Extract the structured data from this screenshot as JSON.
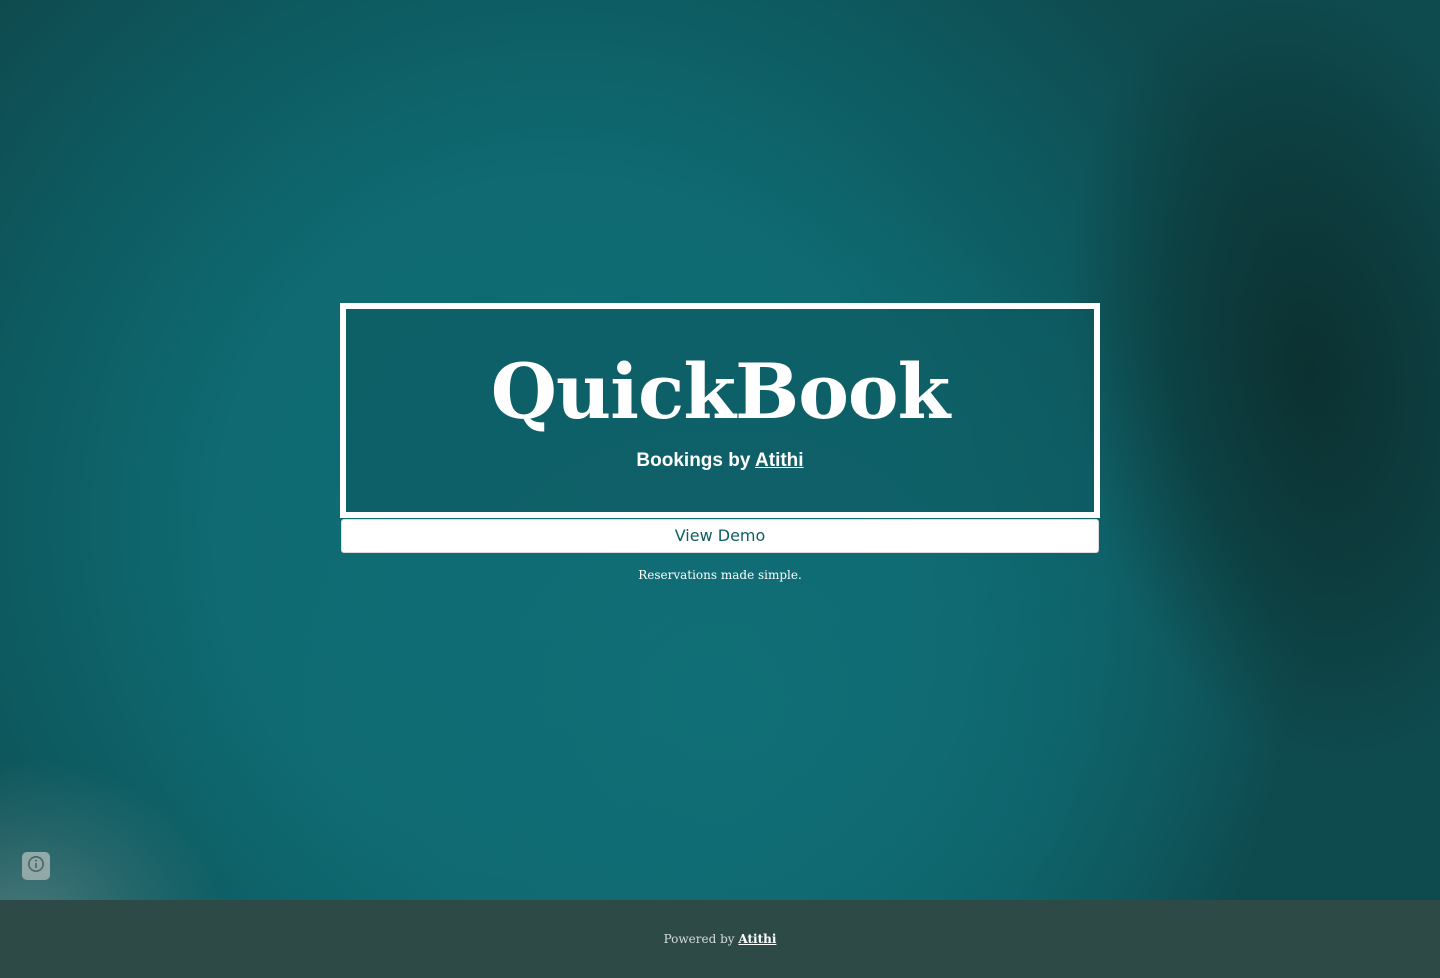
{
  "hero": {
    "title": "QuickBook",
    "subtitle_prefix": "Bookings by ",
    "subtitle_link": "Atithi",
    "demo_button_label": "View Demo",
    "tagline": "Reservations made simple."
  },
  "info_button": {
    "icon": "info-icon"
  },
  "footer": {
    "powered_prefix": "Powered by ",
    "powered_link": "Atithi"
  },
  "colors": {
    "teal_background": "#0f6a71",
    "footer_background": "#2e4a47",
    "button_text": "#0f5e63"
  }
}
